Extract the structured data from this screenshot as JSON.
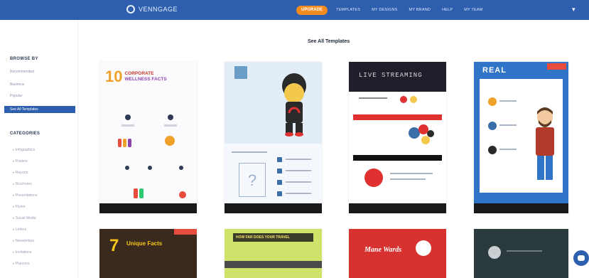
{
  "header": {
    "brand": "VENNGAGE",
    "upgrade_label": "UPGRADE",
    "nav": [
      "TEMPLATES",
      "MY DESIGNS",
      "MY BRAND",
      "HELP",
      "MY TEAM"
    ]
  },
  "main": {
    "title": "See All Templates"
  },
  "sidebar": {
    "browse_heading": "BROWSE BY",
    "browse_items": [
      "Recommended",
      "Business",
      "Popular"
    ],
    "active_item": "See All Templates",
    "categories_heading": "CATEGORIES",
    "categories": [
      "Infographics",
      "Posters",
      "Reports",
      "Brochures",
      "Presentations",
      "Flyers",
      "Social Media",
      "Letters",
      "Newsletters",
      "Invitations",
      "Planners"
    ]
  },
  "cards": {
    "c1_num": "10",
    "c1_line1": "CORPORATE",
    "c1_line2": "WELLNESS FACTS",
    "c3_title": "LIVE STREAMING",
    "c4_title": "REAL",
    "c5_num": "7",
    "c5_title": "Unique Facts",
    "c6_title": "HOW FAR DOES YOUR TRAVEL",
    "c7_title": "Mane Wards"
  },
  "colors": {
    "topbar": "#2d5fae",
    "accent": "#f58a1f",
    "active": "#2d5fae"
  }
}
